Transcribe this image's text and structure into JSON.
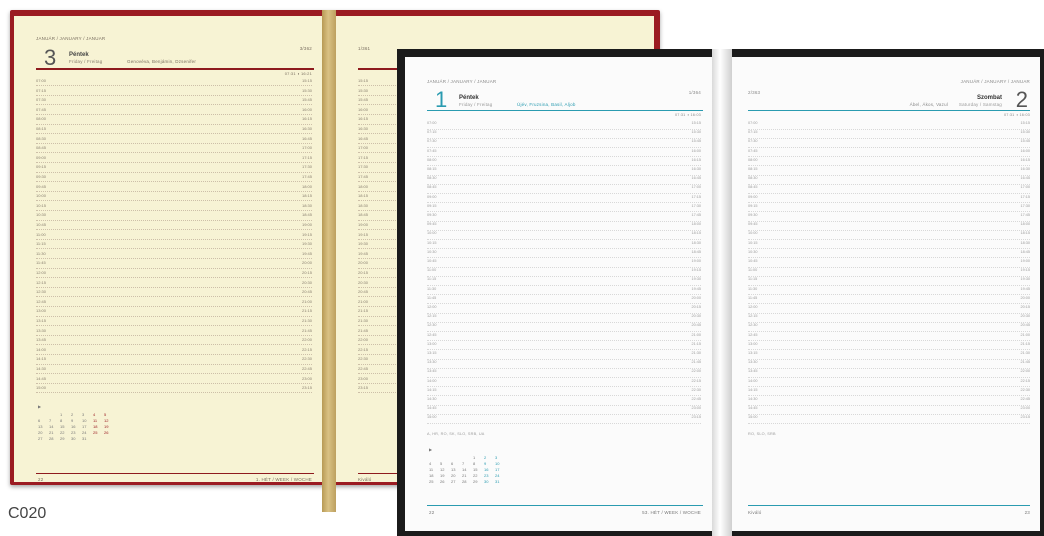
{
  "label": "C020",
  "red_planner": {
    "left_page": {
      "header": "JANUÁR / JANUARY / JANUAR",
      "day_number": "3",
      "day_name": "Péntek",
      "day_sub": "Friday / Freitag",
      "names": "Genovéva, Benjámin, Dzsenifer",
      "day_of_year": "3/362",
      "sun": "07:31 ◑ 16:21",
      "times": [
        "07:00",
        "07:15",
        "07:30",
        "07:45",
        "08:00",
        "08:15",
        "08:30",
        "08:45",
        "09:00",
        "09:15",
        "09:30",
        "09:45",
        "10:00",
        "10:15",
        "10:30",
        "10:45",
        "11:00",
        "11:15",
        "11:30",
        "11:45",
        "12:00",
        "12:15",
        "12:30",
        "12:45",
        "13:00",
        "13:15",
        "13:30",
        "13:45",
        "14:00",
        "14:15",
        "14:30",
        "14:45",
        "15:00"
      ],
      "right_times": [
        "15:15",
        "15:30",
        "15:45",
        "16:00",
        "16:15",
        "16:30",
        "16:45",
        "17:00",
        "17:15",
        "17:30",
        "17:45",
        "18:00",
        "18:15",
        "18:30",
        "18:45",
        "19:00",
        "19:15",
        "19:30",
        "19:45",
        "20:00",
        "20:15",
        "20:30",
        "20:45",
        "21:00",
        "21:15",
        "21:30",
        "21:45",
        "22:00",
        "22:15",
        "22:30",
        "22:45",
        "23:00",
        "23:15"
      ],
      "calendar": [
        [
          "",
          "",
          "1",
          "2",
          "3",
          "4",
          "5"
        ],
        [
          "6",
          "7",
          "8",
          "9",
          "10",
          "11",
          "12"
        ],
        [
          "13",
          "14",
          "15",
          "16",
          "17",
          "18",
          "19"
        ],
        [
          "20",
          "21",
          "22",
          "23",
          "24",
          "25",
          "26"
        ],
        [
          "27",
          "28",
          "29",
          "30",
          "31",
          "",
          ""
        ]
      ],
      "page_number": "22",
      "footer": "1. HÉT / WEEK / WOCHE"
    },
    "right_page": {
      "header": "1/361",
      "footer": "Kiváló"
    }
  },
  "black_planner": {
    "left_page": {
      "header": "JANUÁR / JANUARY / JANUAR",
      "day_number": "1",
      "day_name": "Péntek",
      "day_sub": "Friday / Freitag",
      "names": "Újév, Fruzsina, Basil, Aljob",
      "day_of_year": "1/364",
      "sun": "07:31 ◑ 16:03",
      "times": [
        "07:00",
        "07:15",
        "07:30",
        "07:45",
        "08:00",
        "08:15",
        "08:30",
        "08:45",
        "09:00",
        "09:15",
        "09:30",
        "09:45",
        "10:00",
        "10:15",
        "10:30",
        "10:45",
        "11:00",
        "11:15",
        "11:30",
        "11:45",
        "12:00",
        "12:15",
        "12:30",
        "12:45",
        "13:00",
        "13:15",
        "13:30",
        "13:45",
        "14:00",
        "14:15",
        "14:30",
        "14:45",
        "15:00"
      ],
      "right_times": [
        "15:15",
        "15:30",
        "15:45",
        "16:00",
        "16:15",
        "16:30",
        "16:45",
        "17:00",
        "17:15",
        "17:30",
        "17:45",
        "18:00",
        "18:15",
        "18:30",
        "18:45",
        "19:00",
        "19:15",
        "19:30",
        "19:45",
        "20:00",
        "20:15",
        "20:30",
        "20:45",
        "21:00",
        "21:15",
        "21:30",
        "21:45",
        "22:00",
        "22:15",
        "22:30",
        "22:45",
        "23:00",
        "23:15"
      ],
      "country_note": "A, HR, RO, SK, SLO, SRB, UA",
      "calendar": [
        [
          "",
          "",
          "",
          "",
          "1",
          "2",
          "3"
        ],
        [
          "4",
          "5",
          "6",
          "7",
          "8",
          "9",
          "10"
        ],
        [
          "11",
          "12",
          "13",
          "14",
          "15",
          "16",
          "17"
        ],
        [
          "18",
          "19",
          "20",
          "21",
          "22",
          "23",
          "24"
        ],
        [
          "25",
          "26",
          "27",
          "28",
          "29",
          "30",
          "31"
        ]
      ],
      "page_number": "22",
      "footer": "53. HÉT / WEEK / WOCHE"
    },
    "right_page": {
      "header": "JANUÁR / JANUARY / JANUAR",
      "day_of_year": "2/363",
      "day_number": "2",
      "day_name": "Szombat",
      "day_sub": "Saturday / Samstag",
      "names": "Ábel, Ákos, Vazul",
      "sun": "07:31 ◑ 16:03",
      "country_note": "RO, SLO, SRB",
      "page_number": "23",
      "footer": "Kiváló"
    }
  }
}
